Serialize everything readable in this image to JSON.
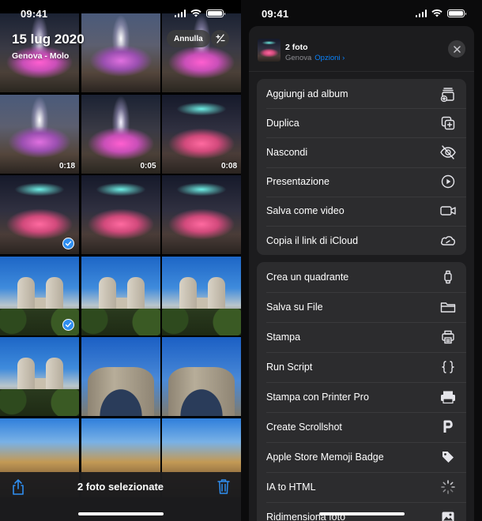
{
  "left": {
    "status": {
      "time": "09:41"
    },
    "header": {
      "title": "15 lug 2020",
      "subtitle": "Genova - Molo",
      "cancel_label": "Annulla",
      "toggle_label": "+/-"
    },
    "tiles": [
      {
        "kind": "fountain",
        "duration": ""
      },
      {
        "kind": "fountain dusk",
        "duration": ""
      },
      {
        "kind": "fountain",
        "duration": ""
      },
      {
        "kind": "fountain dusk",
        "duration": "0:18"
      },
      {
        "kind": "fountain",
        "duration": "0:05"
      },
      {
        "kind": "fountain teal",
        "duration": "0:08"
      },
      {
        "kind": "fountain teal",
        "duration": "",
        "selected": true
      },
      {
        "kind": "fountain teal",
        "duration": ""
      },
      {
        "kind": "fountain teal",
        "duration": ""
      },
      {
        "kind": "sky",
        "duration": "",
        "selected": true
      },
      {
        "kind": "sky",
        "duration": ""
      },
      {
        "kind": "sky",
        "duration": ""
      },
      {
        "kind": "sky",
        "duration": ""
      },
      {
        "kind": "arch",
        "duration": ""
      },
      {
        "kind": "arch",
        "duration": ""
      },
      {
        "kind": "street",
        "duration": ""
      },
      {
        "kind": "street",
        "duration": ""
      },
      {
        "kind": "street",
        "duration": ""
      }
    ],
    "bottom": {
      "selection_label": "2 foto selezionate"
    },
    "colors": {
      "accent": "#2f8ef0"
    }
  },
  "right": {
    "status": {
      "time": "09:41"
    },
    "sheet": {
      "title": "2 foto",
      "location": "Genova",
      "options_label": "Opzioni ›"
    },
    "group1": [
      {
        "label": "Aggiungi ad album",
        "icon": "add-to-album-icon"
      },
      {
        "label": "Duplica",
        "icon": "duplicate-icon"
      },
      {
        "label": "Nascondi",
        "icon": "hide-eye-icon"
      },
      {
        "label": "Presentazione",
        "icon": "play-icon"
      },
      {
        "label": "Salva come video",
        "icon": "video-camera-icon"
      },
      {
        "label": "Copia il link di iCloud",
        "icon": "link-icon"
      }
    ],
    "group2": [
      {
        "label": "Crea un quadrante",
        "icon": "watch-icon"
      },
      {
        "label": "Salva su File",
        "icon": "folder-icon"
      },
      {
        "label": "Stampa",
        "icon": "printer-icon"
      },
      {
        "label": "Run Script",
        "icon": "braces-icon"
      },
      {
        "label": "Stampa con Printer Pro",
        "icon": "printer-pro-icon"
      },
      {
        "label": "Create Scrollshot",
        "icon": "p-icon"
      },
      {
        "label": "Apple Store Memoji Badge",
        "icon": "tag-icon"
      },
      {
        "label": "IA to HTML",
        "icon": "loading-spinner-icon"
      },
      {
        "label": "Ridimensiona foto",
        "icon": "photo-icon"
      }
    ],
    "colors": {
      "link": "#0a84ff",
      "sheet_bg": "#1c1c1e",
      "group_bg": "#2c2c2e"
    }
  }
}
